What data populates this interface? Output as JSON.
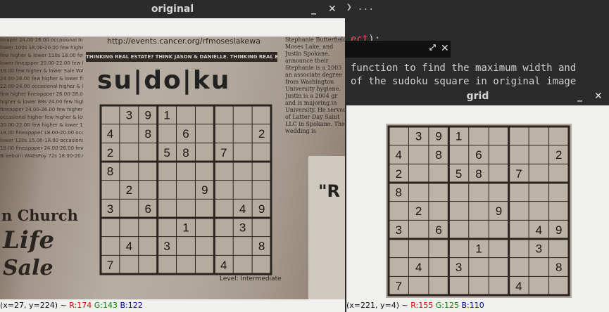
{
  "editor": {
    "top_text": "❯ ...",
    "line1_kw": "ect",
    "line1_rest": ");",
    "line2": "function to find the maximum width and",
    "line3": "of the sudoku square in original image"
  },
  "original_window": {
    "title": "original",
    "url": "http://events.cancer.org/rfmoseslakewa",
    "banner": "THINKING REAL ESTATE? THINK JASON & DANIELLE. THINKING REAL ESTATE? THINK JASON & DANIELLE.",
    "sudoku_title": "su|do|ku",
    "level": "Level: Intermediate",
    "left_column": [
      "Ireaper 24.00-26.00 occasional higher &",
      "lower 100s 18.00-20.00 few higher &",
      "few higher & lower 110s 18.00 few higher &",
      "lower fineapper 20.00-22.00 few higher &",
      "18.00 few higher & lower Sale WAEsFoy",
      "24.00-26.00 few higher & lower fineappper",
      "22.00-24.00 occasional higher & lower 80s",
      "few higher fineappper 26.00-28.00 occa-",
      "higher & lower 88s 24.00 few higher",
      "fineapper 24.00-26.00 few higher & lower",
      "occasional higher few higher & lower finap-",
      "20.00-22.00 few higher & lower 113s",
      "18.00 fineappper 18.00-20.00 occasional",
      "lower 120s 15.00-18.00 occasional",
      "18.00 fineappper 24.00-26.00 few higher",
      "Braeburn WAEsFoy 72s 18.00-20.00"
    ],
    "church": [
      "n Church",
      "Life",
      "Sale"
    ],
    "right_column": "Stephanie Butterfield Moses Lake, and Justin Spokane, announce their Stephanie is a 2003 an associate degree from Washington University hygiene. Justin is a 2004 gr and is majoring in University. He served of Latter Day Saint LLC in Spokane. The wedding is",
    "ad_text": "\"R",
    "status": {
      "coords": "(x=27, y=224) ~",
      "r": "R:174",
      "g": "G:143",
      "b": "B:122"
    }
  },
  "grid_window": {
    "title": "grid",
    "status": {
      "coords": "(x=221, y=4) ~",
      "r": "R:155",
      "g": "G:125",
      "b": "B:110"
    }
  },
  "sudoku": [
    [
      "",
      "3",
      "9",
      "1",
      "",
      "",
      "",
      "",
      ""
    ],
    [
      "4",
      "",
      "8",
      "",
      "6",
      "",
      "",
      "",
      "2"
    ],
    [
      "2",
      "",
      "",
      "5",
      "8",
      "",
      "7",
      "",
      ""
    ],
    [
      "8",
      "",
      "",
      "",
      "",
      "",
      "",
      "",
      ""
    ],
    [
      "",
      "2",
      "",
      "",
      "",
      "9",
      "",
      "",
      ""
    ],
    [
      "3",
      "",
      "6",
      "",
      "",
      "",
      "",
      "4",
      "9"
    ],
    [
      "",
      "",
      "",
      "",
      "1",
      "",
      "",
      "3",
      ""
    ],
    [
      "",
      "4",
      "",
      "3",
      "",
      "",
      "",
      "",
      "8"
    ],
    [
      "7",
      "",
      "",
      "",
      "",
      "",
      "4",
      "",
      ""
    ]
  ],
  "icons": {
    "minimize": "minimize-icon",
    "close": "close-icon",
    "expand": "expand-icon"
  }
}
